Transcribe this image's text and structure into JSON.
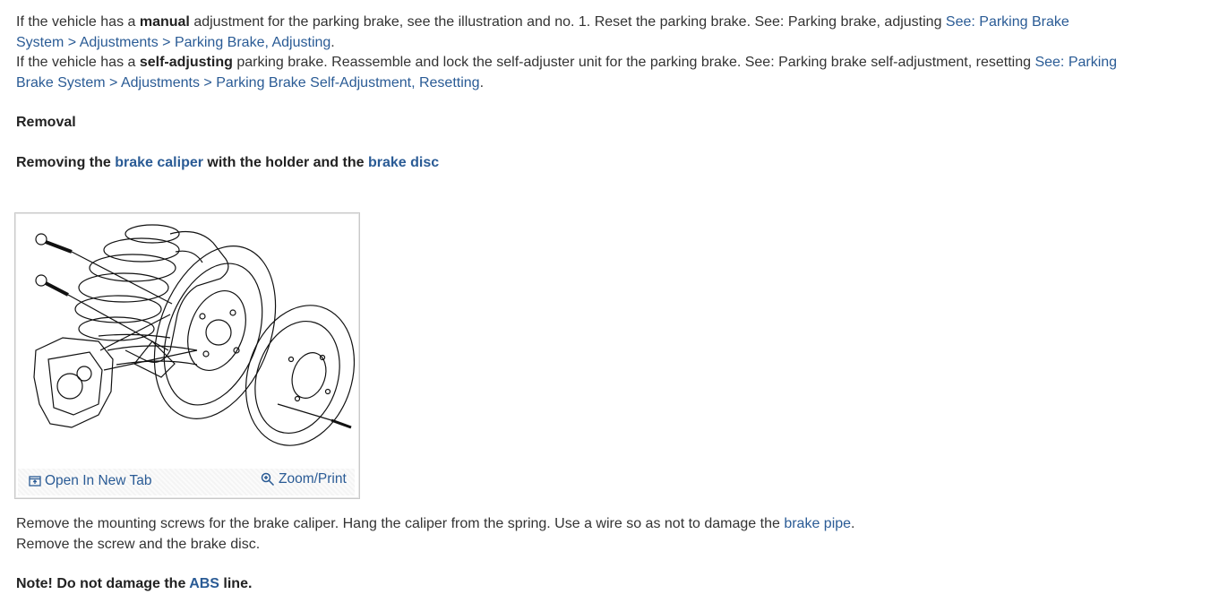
{
  "intro": {
    "line1_pre": "If the vehicle has a ",
    "line1_bold": "manual",
    "line1_post": " adjustment for the parking brake, see the illustration and no. 1. Reset the parking brake. See: Parking brake, adjusting ",
    "line1_link": "See: Parking Brake System > Adjustments > Parking Brake, Adjusting",
    "line1_end": ".",
    "line2_pre": "If the vehicle has a ",
    "line2_bold": "self-adjusting",
    "line2_post": " parking brake. Reassemble and lock the self-adjuster unit for the parking brake. See: Parking brake self-adjustment, resetting ",
    "line2_link": "See: Parking Brake System > Adjustments > Parking Brake Self-Adjustment, Resetting",
    "line2_end": "."
  },
  "removal_heading": "Removal",
  "subheading": {
    "pre": "Removing the ",
    "link1": "brake caliper",
    "mid": " with the holder and the ",
    "link2": "brake disc"
  },
  "figure": {
    "open_tab_label": "Open In New Tab",
    "zoom_label": "Zoom/Print"
  },
  "steps": {
    "line1_pre": "Remove the mounting screws for the brake caliper. Hang the caliper from the spring. Use a wire so as not to damage the ",
    "line1_link": "brake pipe",
    "line1_end": ".",
    "line2": "Remove the screw and the brake disc."
  },
  "note": {
    "pre": "Note! Do not damage the ",
    "link": "ABS",
    "post": " line."
  },
  "colors": {
    "link": "#2a5b95",
    "text": "#333333"
  }
}
